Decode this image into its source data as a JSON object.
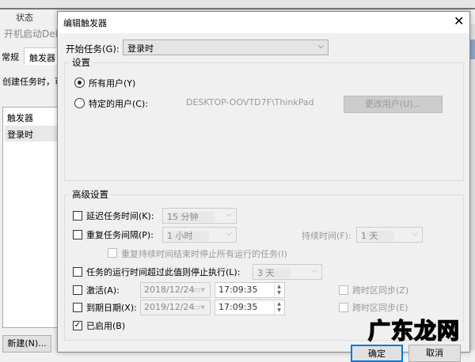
{
  "background_window": {
    "tab_top_partial": "状态",
    "title": "开机启动Debi",
    "tabs": [
      "常规",
      "触发器"
    ],
    "description": "创建任务时，可",
    "list_header": "触发器",
    "list_rows": [
      "登录时"
    ],
    "new_button": "新建(N)..."
  },
  "dialog": {
    "title": "编辑触发器",
    "close_icon": "close-icon",
    "start_task_label": "开始任务(G):",
    "start_task_value": "登录时",
    "settings": {
      "legend": "设置",
      "all_users_label": "所有用户(Y)",
      "all_users_selected": true,
      "specific_user_label": "特定的用户(C):",
      "user_name": "DESKTOP-OOVTD7F\\ThinkPad",
      "change_user_button": "更改用户(U)..."
    },
    "advanced": {
      "legend": "高级设置",
      "delay_label": "延迟任务时间(K):",
      "delay_value": "15 分钟",
      "repeat_label": "重复任务间隔(P):",
      "repeat_value": "1 小时",
      "duration_label": "持续时间(F):",
      "duration_value": "1 天",
      "stop_all_label": "重复持续时间结束时停止所有运行的任务(I)",
      "stop_exec_label": "任务的运行时间超过此值则停止执行(L):",
      "stop_exec_value": "3 天",
      "activate_label": "激活(A):",
      "activate_date": "2018/12/24",
      "activate_time": "17:09:35",
      "activate_sync_label": "跨时区同步(Z)",
      "expire_label": "到期日期(X):",
      "expire_date": "2019/12/24",
      "expire_time": "17:09:35",
      "expire_sync_label": "跨时区同步(E)",
      "enabled_label": "已启用(B)",
      "enabled_checked": true
    },
    "ok_button": "确定",
    "cancel_button": "取消"
  },
  "watermark": "广东龙网"
}
